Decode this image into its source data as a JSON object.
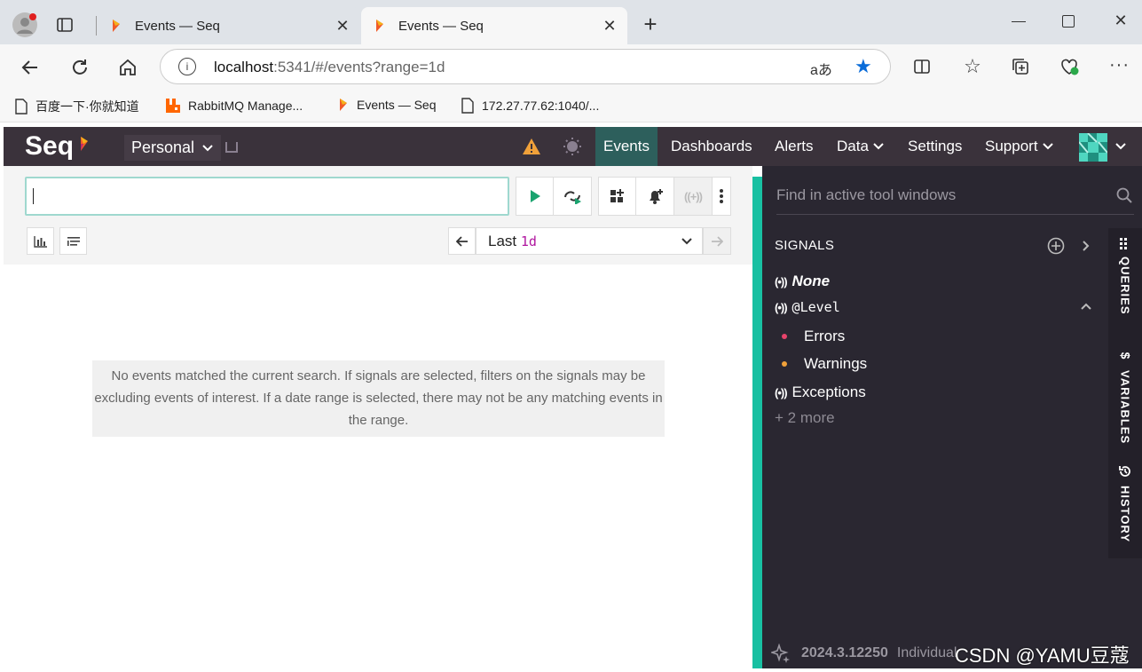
{
  "browser": {
    "tabs": [
      {
        "title": "Events — Seq",
        "active": false
      },
      {
        "title": "Events — Seq",
        "active": true
      }
    ],
    "address": {
      "host": "localhost",
      "path": ":5341/#/events?range=1d",
      "info_icon": "info-icon"
    },
    "bookmarks": [
      {
        "label": "百度一下·你就知道",
        "icon": "page-icon"
      },
      {
        "label": "RabbitMQ Manage...",
        "icon": "rabbitmq-icon"
      },
      {
        "label": "Events — Seq",
        "icon": "seq-icon"
      },
      {
        "label": "172.27.77.62:1040/...",
        "icon": "page-icon"
      }
    ]
  },
  "seq": {
    "logo": "Seq",
    "workspace": "Personal",
    "nav": [
      "Events",
      "Dashboards",
      "Alerts",
      "Data",
      "Settings",
      "Support"
    ],
    "active_nav": "Events",
    "search_placeholder": "",
    "range": {
      "prefix": "Last",
      "value": "1d"
    },
    "empty_message": "No events matched the current search. If signals are selected, filters on the signals may be excluding events of interest. If a date range is selected, there may not be any matching events in the range.",
    "tool_search_placeholder": "Find in active tool windows",
    "signals_header": "SIGNALS",
    "signals": [
      {
        "label": "None",
        "style": "italic"
      },
      {
        "label": "@Level",
        "style": "mono"
      },
      {
        "label": "Errors",
        "dot": "#e8436b"
      },
      {
        "label": "Warnings",
        "dot": "#f0a13a"
      },
      {
        "label": "Exceptions",
        "style": "normal"
      }
    ],
    "more": "+ 2 more",
    "side_tabs": [
      "QUERIES",
      "VARIABLES",
      "HISTORY"
    ],
    "version": "2024.3.12250",
    "edition": "Individual",
    "watermark": "CSDN @YAMU豆蔻",
    "colors": {
      "accent": "#18c0a2",
      "nav_bg": "#3a323b",
      "active_nav_bg": "#2d5f5c",
      "panel_bg": "#2a2731"
    }
  }
}
